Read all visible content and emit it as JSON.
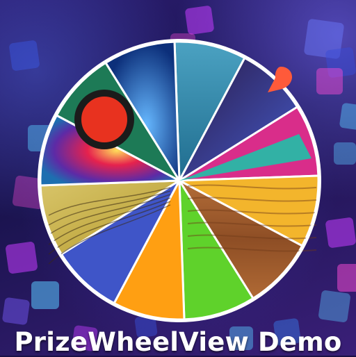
{
  "app": {
    "title": "PrizeWheelView Demo"
  },
  "colors": {
    "pointer": "#ff5a3a",
    "rim": "#ffffff",
    "tile_magenta": "#c43cff",
    "tile_blue": "#59c9ff",
    "tile_pink": "#ff4bd7"
  },
  "wheel": {
    "segments": [
      {
        "name": "wheel-segment-steel-blue",
        "fill": "#3a8fb0"
      },
      {
        "name": "wheel-segment-dark-bokeh",
        "fill": "#2a3a8c"
      },
      {
        "name": "wheel-segment-magenta-wedge",
        "fill": "#d92d8a"
      },
      {
        "name": "wheel-segment-orange-teal-mix",
        "fill": "#f3b52c"
      },
      {
        "name": "wheel-segment-wood-texture",
        "fill": "#9b5a2e"
      },
      {
        "name": "wheel-segment-green",
        "fill": "#5fd22b"
      },
      {
        "name": "wheel-segment-orange",
        "fill": "#ff9f12"
      },
      {
        "name": "wheel-segment-indigo",
        "fill": "#3f55c8"
      },
      {
        "name": "wheel-segment-wing-texture",
        "fill": "#c9b44c"
      },
      {
        "name": "wheel-segment-flower",
        "fill": "#b81c5a"
      },
      {
        "name": "wheel-segment-red-circle",
        "fill": "#1d7a56"
      },
      {
        "name": "wheel-segment-blue-light",
        "fill": "#1f5fc4"
      }
    ]
  }
}
